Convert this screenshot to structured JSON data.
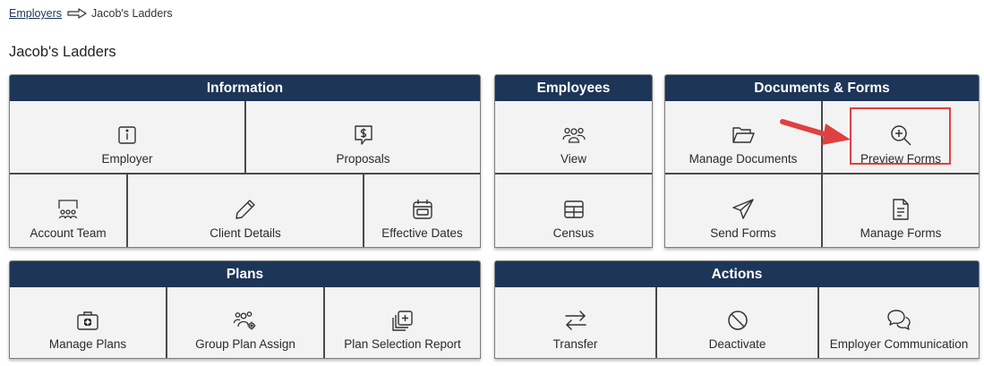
{
  "breadcrumb": {
    "parent": "Employers",
    "current": "Jacob's Ladders",
    "separator_icon": "arrow-right-outline-icon"
  },
  "page_title": "Jacob's Ladders",
  "panels": {
    "information": {
      "title": "Information",
      "items": [
        {
          "label": "Employer",
          "icon": "info-icon"
        },
        {
          "label": "Proposals",
          "icon": "dollar-chat-icon"
        },
        {
          "label": "Account Team",
          "icon": "presentation-team-icon"
        },
        {
          "label": "Client Details",
          "icon": "pencil-icon"
        },
        {
          "label": "Effective Dates",
          "icon": "calendar-icon"
        }
      ]
    },
    "employees": {
      "title": "Employees",
      "items": [
        {
          "label": "View",
          "icon": "users-icon"
        },
        {
          "label": "Census",
          "icon": "table-icon"
        }
      ]
    },
    "documents": {
      "title": "Documents & Forms",
      "items": [
        {
          "label": "Manage Documents",
          "icon": "folder-open-icon"
        },
        {
          "label": "Preview Forms",
          "icon": "zoom-in-icon"
        },
        {
          "label": "Send Forms",
          "icon": "send-icon"
        },
        {
          "label": "Manage Forms",
          "icon": "file-text-icon"
        }
      ]
    },
    "plans": {
      "title": "Plans",
      "items": [
        {
          "label": "Manage Plans",
          "icon": "medical-kit-icon"
        },
        {
          "label": "Group Plan Assign",
          "icon": "users-gear-icon"
        },
        {
          "label": "Plan Selection Report",
          "icon": "stacked-plus-icon"
        }
      ]
    },
    "actions": {
      "title": "Actions",
      "items": [
        {
          "label": "Transfer",
          "icon": "transfer-arrows-icon"
        },
        {
          "label": "Deactivate",
          "icon": "ban-icon"
        },
        {
          "label": "Employer Communication",
          "icon": "chat-bubbles-icon"
        }
      ]
    }
  },
  "annotation": {
    "highlight_color": "#e04040",
    "target_item": "Preview Forms"
  },
  "colors": {
    "header_bg": "#1d3557",
    "tile_bg": "#f3f3f3",
    "divider": "#4a4a4a"
  }
}
